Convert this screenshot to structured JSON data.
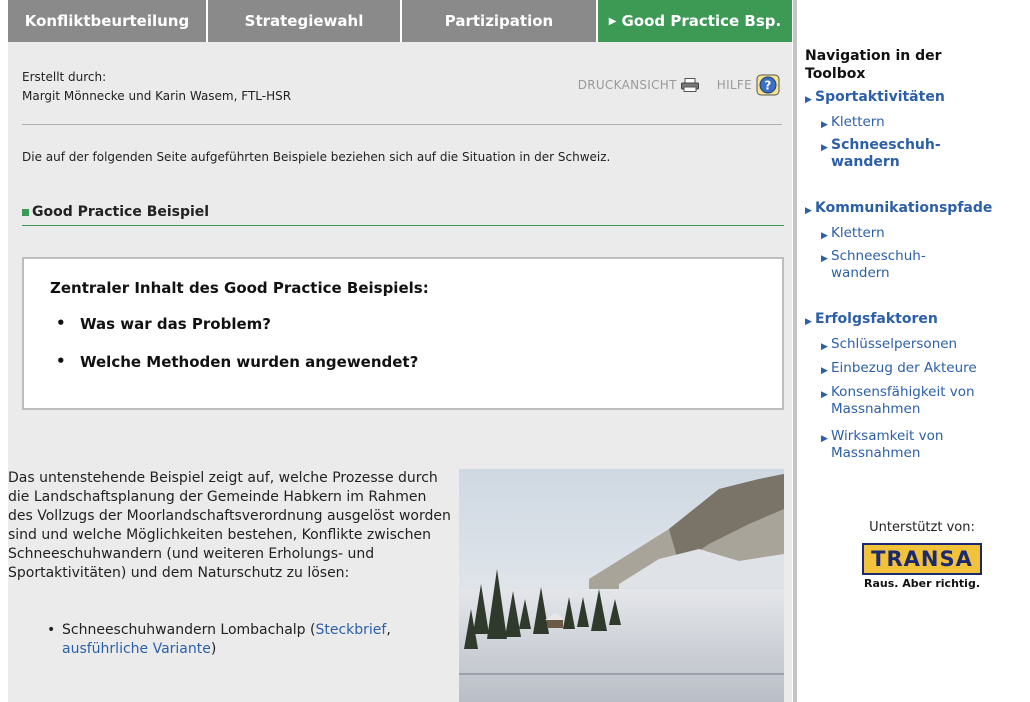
{
  "tabs": [
    {
      "label": "Konfliktbeurteilung",
      "active": false
    },
    {
      "label": "Strategiewahl",
      "active": false
    },
    {
      "label": "Partizipation",
      "active": false
    },
    {
      "label": "Good Practice Bsp.",
      "active": true
    }
  ],
  "header": {
    "created_label": "Erstellt durch:",
    "created_by": "Margit Mönnecke und Karin Wasem, FTL-HSR",
    "print_label": "DRUCKANSICHT",
    "help_label": "HILFE"
  },
  "intro_text": "Die auf der folgenden Seite aufgeführten Beispiele beziehen sich auf die Situation in der Schweiz.",
  "section_title": "Good Practice Beispiel",
  "box": {
    "title": "Zentraler Inhalt des Good Practice Beispiels:",
    "bullets": [
      "Was war das Problem?",
      "Welche Methoden wurden angewendet?"
    ]
  },
  "body": {
    "paragraph": "Das untenstehende Beispiel zeigt auf, welche Prozesse durch die Landschaftsplanung der Gemeinde Habkern im Rahmen des Vollzugs der Moorlandschaftsverordnung ausgelöst worden sind und welche Möglichkeiten bestehen, Konflikte zwischen Schneeschuhwandern (und weiteren Erholungs- und Sportaktivitäten) und dem Naturschutz zu lösen:",
    "list_item_prefix": "Schneeschuhwandern Lombachalp (",
    "link_steckbrief": "Steckbrief",
    "list_item_comma": ",",
    "link_variante": "ausführliche Variante",
    "list_item_suffix": ")"
  },
  "nav": {
    "title": "Navigation in der Toolbox",
    "sportaktivitaeten": "Sportaktivitäten",
    "sport_klettern": "Klettern",
    "sport_schnee": "Schneeschuh-wandern",
    "kommunikationspfade": "Kommunikationspfade",
    "komm_klettern": "Klettern",
    "komm_schnee": "Schneeschuh-wandern",
    "erfolgsfaktoren": "Erfolgsfaktoren",
    "schluesselpersonen": "Schlüsselpersonen",
    "einbezug": "Einbezug der Akteure",
    "konsens": "Konsensfähigkeit von Massnahmen",
    "wirksamkeit": "Wirksamkeit von Massnahmen"
  },
  "support": {
    "label": "Unterstützt von:",
    "logo_text": "TRANSA",
    "slogan": "Raus. Aber richtig."
  },
  "colors": {
    "tab_active": "#3c9a55",
    "tab_inactive": "#8a8a8a",
    "link": "#2c5fa8",
    "content_bg": "#ebebeb"
  },
  "icons": [
    "printer-icon",
    "help-icon",
    "triangle-right-icon"
  ]
}
